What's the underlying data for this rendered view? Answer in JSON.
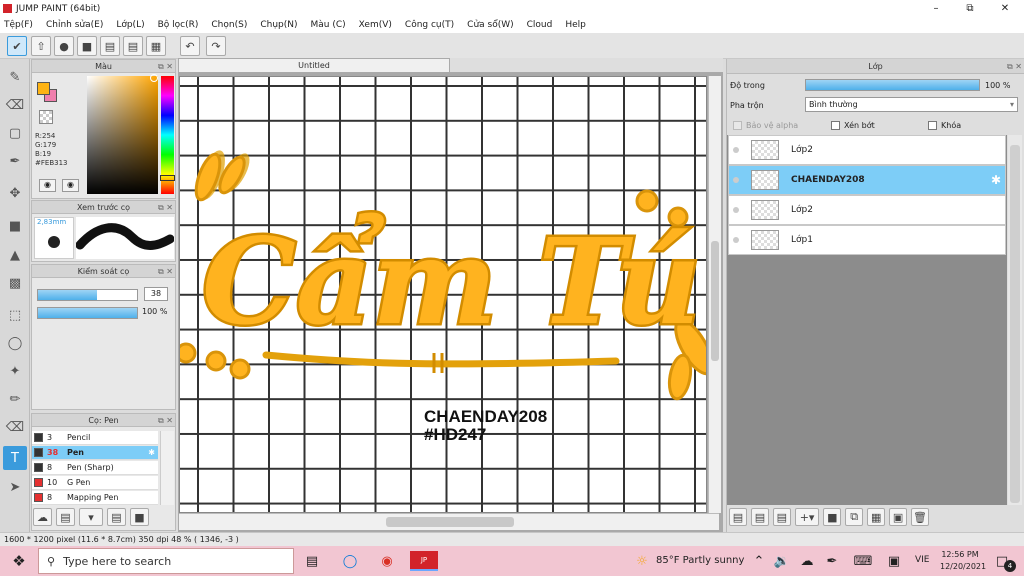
{
  "app": {
    "title": "JUMP PAINT (64bit)"
  },
  "menu": [
    "Tệp(F)",
    "Chỉnh sửa(E)",
    "Lớp(L)",
    "Bộ lọc(R)",
    "Chọn(S)",
    "Chụp(N)",
    "Màu (C)",
    "Xem(V)",
    "Công cụ(T)",
    "Cửa sổ(W)",
    "Cloud",
    "Help"
  ],
  "document": {
    "tab": "Untitled"
  },
  "color_panel": {
    "title": "Màu",
    "r": "R:254",
    "g": "G:179",
    "b": "B:19",
    "hex": "#FEB313",
    "fg_color": "#FEB313",
    "bg_color": "#F07FAD"
  },
  "preview_panel": {
    "title": "Xem trước cọ",
    "size": "2,83mm"
  },
  "control_panel": {
    "title": "Kiểm soát cọ",
    "size_value": "38",
    "size_fraction": 0.6,
    "opacity_value": "100 %",
    "opacity_fraction": 1.0
  },
  "brush_panel": {
    "title": "Cọ: Pen",
    "items": [
      {
        "num": "3",
        "name": "Pencil",
        "color": "#333333"
      },
      {
        "num": "38",
        "name": "Pen",
        "color": "#333333"
      },
      {
        "num": "8",
        "name": "Pen (Sharp)",
        "color": "#333333"
      },
      {
        "num": "10",
        "name": "G Pen",
        "color": "#e53030"
      },
      {
        "num": "8",
        "name": "Mapping Pen",
        "color": "#e53030"
      }
    ]
  },
  "layer_panel": {
    "title": "Lớp",
    "opacity_label": "Độ trong",
    "opacity_value": "100 %",
    "opacity_fraction": 1.0,
    "blend_label": "Pha trộn",
    "blend_value": "Bình thường",
    "protect_alpha": "Bảo vệ alpha",
    "clipping": "Xén bớt",
    "lock": "Khóa",
    "layers": [
      {
        "name": "Lớp2",
        "selected": false
      },
      {
        "name": "CHAENDAY208",
        "selected": true
      },
      {
        "name": "Lớp2",
        "selected": false
      },
      {
        "name": "Lớp1",
        "selected": false
      }
    ]
  },
  "artwork": {
    "main_text": "Cẩm Tú",
    "sub1": "CHAENDAY208",
    "sub2": "#HD247"
  },
  "status": {
    "text": "1600 * 1200 pixel   (11.6 * 8.7cm)   350 dpi   48 %   ( 1346, -3 )"
  },
  "taskbar": {
    "search_placeholder": "Type here to search",
    "weather": "85°F  Partly sunny",
    "lang": "VIE",
    "time": "12:56 PM",
    "date": "12/20/2021",
    "notif_count": "4"
  }
}
